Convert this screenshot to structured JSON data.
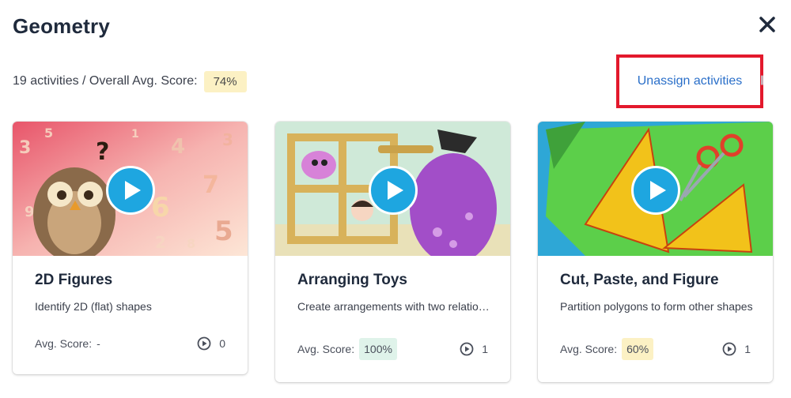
{
  "header": {
    "title": "Geometry",
    "summary_text": "19 activities / Overall Avg. Score:",
    "overall_score": "74%",
    "unassign_label": "Unassign activities"
  },
  "cards": [
    {
      "title": "2D Figures",
      "description": "Identify 2D (flat) shapes",
      "avg_label": "Avg. Score:",
      "avg_value": "-",
      "plays": "0"
    },
    {
      "title": "Arranging Toys",
      "description": "Create arrangements with two relationships",
      "avg_label": "Avg. Score:",
      "avg_value": "100%",
      "plays": "1"
    },
    {
      "title": "Cut, Paste, and Figure",
      "description": "Partition polygons to form other shapes",
      "avg_label": "Avg. Score:",
      "avg_value": "60%",
      "plays": "1"
    }
  ],
  "colors": {
    "accent_link": "#2a6fc9",
    "highlight_box": "#e3192c",
    "play_button": "#1ea6e0",
    "score_good": "#dff3ea",
    "score_mid": "#fcf1c4"
  }
}
